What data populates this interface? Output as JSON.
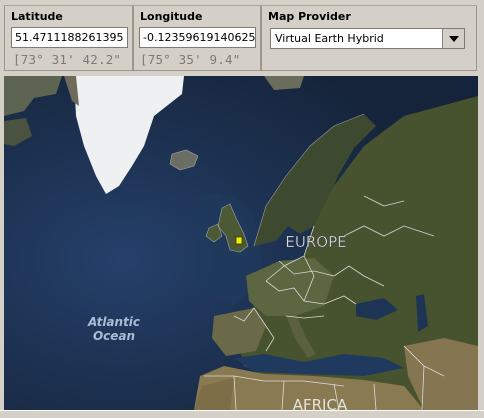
{
  "latitude": {
    "label": "Latitude",
    "value": "51.4711188261395",
    "dms": "[73° 31' 42.2\""
  },
  "longitude": {
    "label": "Longitude",
    "value": "-0.12359619140625",
    "dms": "[75° 35' 9.4\""
  },
  "provider": {
    "label": "Map Provider",
    "selected": "Virtual Earth Hybrid"
  },
  "map": {
    "labels": {
      "europe": "EUROPE",
      "ocean_line1": "Atlantic",
      "ocean_line2": "Ocean",
      "africa": "AFRICA"
    },
    "marker_color": "#f2ef00"
  }
}
